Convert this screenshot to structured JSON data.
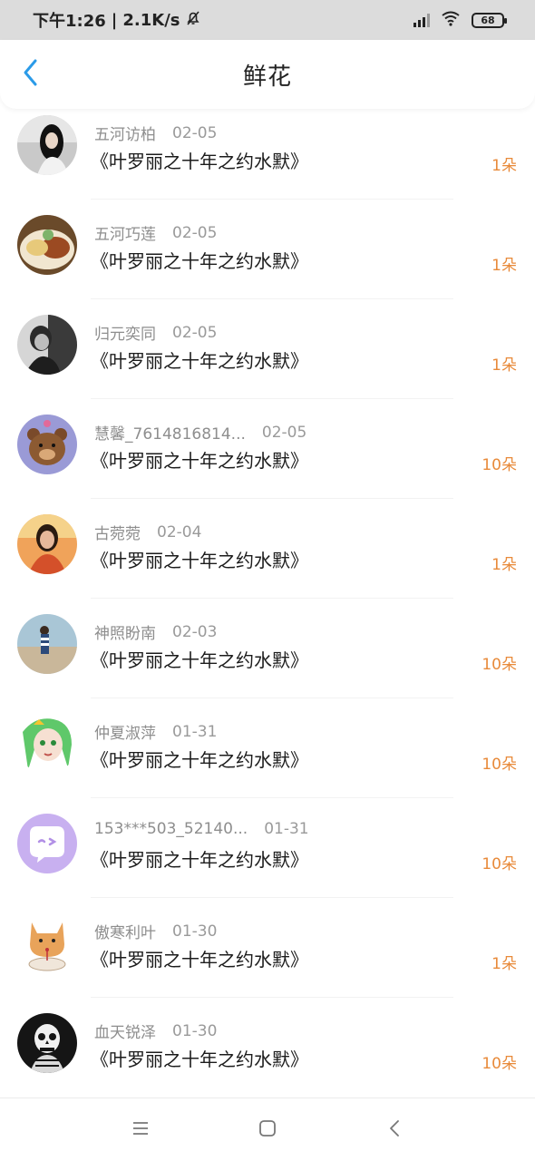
{
  "status_bar": {
    "time": "下午1:26",
    "speed": "2.1K/s",
    "battery": "68"
  },
  "header": {
    "title": "鲜花"
  },
  "list": [
    {
      "name": "五河访柏",
      "date": "02-05",
      "book": "《叶罗丽之十年之约水默》",
      "count": "1朵"
    },
    {
      "name": "五河巧莲",
      "date": "02-05",
      "book": "《叶罗丽之十年之约水默》",
      "count": "1朵"
    },
    {
      "name": "归元奕同",
      "date": "02-05",
      "book": "《叶罗丽之十年之约水默》",
      "count": "1朵"
    },
    {
      "name": "慧馨_7614816814...",
      "date": "02-05",
      "book": "《叶罗丽之十年之约水默》",
      "count": "10朵"
    },
    {
      "name": "古菀菀",
      "date": "02-04",
      "book": "《叶罗丽之十年之约水默》",
      "count": "1朵"
    },
    {
      "name": "神照盼南",
      "date": "02-03",
      "book": "《叶罗丽之十年之约水默》",
      "count": "10朵"
    },
    {
      "name": "仲夏淑萍",
      "date": "01-31",
      "book": "《叶罗丽之十年之约水默》",
      "count": "10朵"
    },
    {
      "name": "153***503_52140...",
      "date": "01-31",
      "book": "《叶罗丽之十年之约水默》",
      "count": "10朵"
    },
    {
      "name": "傲寒利叶",
      "date": "01-30",
      "book": "《叶罗丽之十年之约水默》",
      "count": "1朵"
    },
    {
      "name": "血天锐泽",
      "date": "01-30",
      "book": "《叶罗丽之十年之约水默》",
      "count": "10朵"
    }
  ],
  "colors": {
    "accent": "#2b9be8",
    "count": "#e88a3a"
  }
}
